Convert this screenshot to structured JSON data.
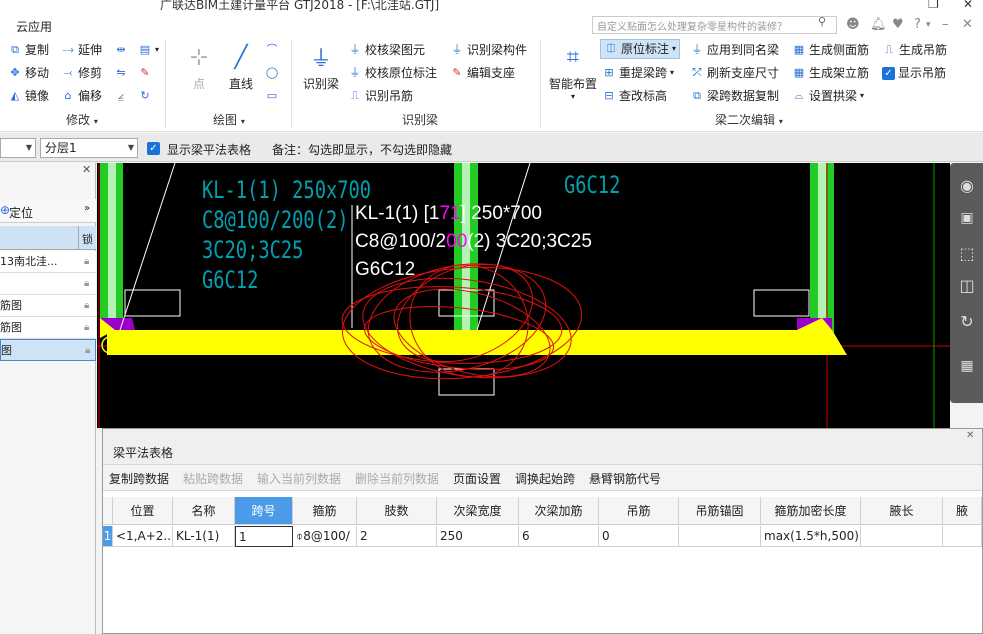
{
  "window": {
    "title": "广联达BIM土建计量平台 GTJ2018 - [F:\\北洼站.GTJ]",
    "restore_icon": "restore-icon",
    "close_icon": "close-icon"
  },
  "menu": {
    "cloud_label": "云应用",
    "help_search_placeholder": "自定义贴面怎么处理复杂零星构件的装修？",
    "toolbar_icons": [
      "user-icon",
      "bell-icon",
      "heart-icon",
      "help-icon",
      "dropdown-icon"
    ]
  },
  "ribbon": {
    "modify": {
      "group_label": "修改",
      "copy": "复制",
      "extend": "延伸",
      "move": "移动",
      "trim": "修剪",
      "mirror": "镜像",
      "offset": "偏移"
    },
    "draw": {
      "group_label": "绘图",
      "point": "点",
      "line": "直线"
    },
    "identify": {
      "group_label": "识别梁",
      "identify_beam": "识别梁",
      "verify_beam": "校核梁图元",
      "verify_original": "校核原位标注",
      "identify_hanging": "识别吊筋",
      "identify_component": "识别梁构件",
      "edit_support": "编辑支座"
    },
    "secondary": {
      "group_label": "梁二次编辑",
      "smart_layout": "智能布置",
      "original_annotation": "原位标注",
      "raise_span": "重提梁跨",
      "check_elevation": "查改标高",
      "apply_same": "应用到同名梁",
      "refresh_support": "刷新支座尺寸",
      "beam_copy": "梁跨数据复制",
      "gen_side_rebar": "生成侧面筋",
      "gen_erect_rebar": "生成架立筋",
      "set_arch": "设置拱梁",
      "gen_hanging": "生成吊筋",
      "show_hanging": "显示吊筋"
    }
  },
  "props": {
    "layer_value": "分层1",
    "show_table_label": "显示梁平法表格",
    "note": "备注：勾选即显示，不勾选即隐藏"
  },
  "left_panel": {
    "locate_label": "定位",
    "lock_header": "锁",
    "rows": [
      "13南北洼...",
      "",
      "筋图",
      "筋图",
      "图"
    ]
  },
  "canvas": {
    "ghost_lines": [
      "KL-1(1) 250x700",
      "C8@100/200(2)",
      "3C20;3C25",
      "G6C12"
    ],
    "top_right": "G6C12",
    "annotation": {
      "line1_pre": "KL-1(1) [1",
      "line1_hl": "71",
      "line1_post": "] 250*700",
      "line2_pre": "C8@100/2",
      "line2_hl": "00",
      "line2_post": "(2) 3C20;3C25",
      "line3": "G6C12"
    }
  },
  "table_panel": {
    "title": "梁平法表格",
    "toolbar": [
      "复制跨数据",
      "粘贴跨数据",
      "输入当前列数据",
      "删除当前列数据",
      "页面设置",
      "调换起始跨",
      "悬臂钢筋代号"
    ],
    "columns": [
      "位置",
      "名称",
      "跨号",
      "箍筋",
      "肢数",
      "次梁宽度",
      "次梁加筋",
      "吊筋",
      "吊筋锚固",
      "箍筋加密长度",
      "腋长",
      "腋"
    ],
    "rows": [
      {
        "num": "1",
        "cells": [
          "<1,A+2...",
          "KL-1(1)",
          "1",
          "8@100/",
          "2",
          "250",
          "6",
          "0",
          "",
          "max(1.5*h,500)",
          "",
          ""
        ]
      }
    ]
  },
  "colors": {
    "accent": "#4c9be8",
    "beam_yellow": "#ffff00",
    "column_green": "#22cc22",
    "canvas_bg": "#000000",
    "annotation_magenta": "#ff00ff",
    "ghost_cyan": "#00a0b0"
  }
}
